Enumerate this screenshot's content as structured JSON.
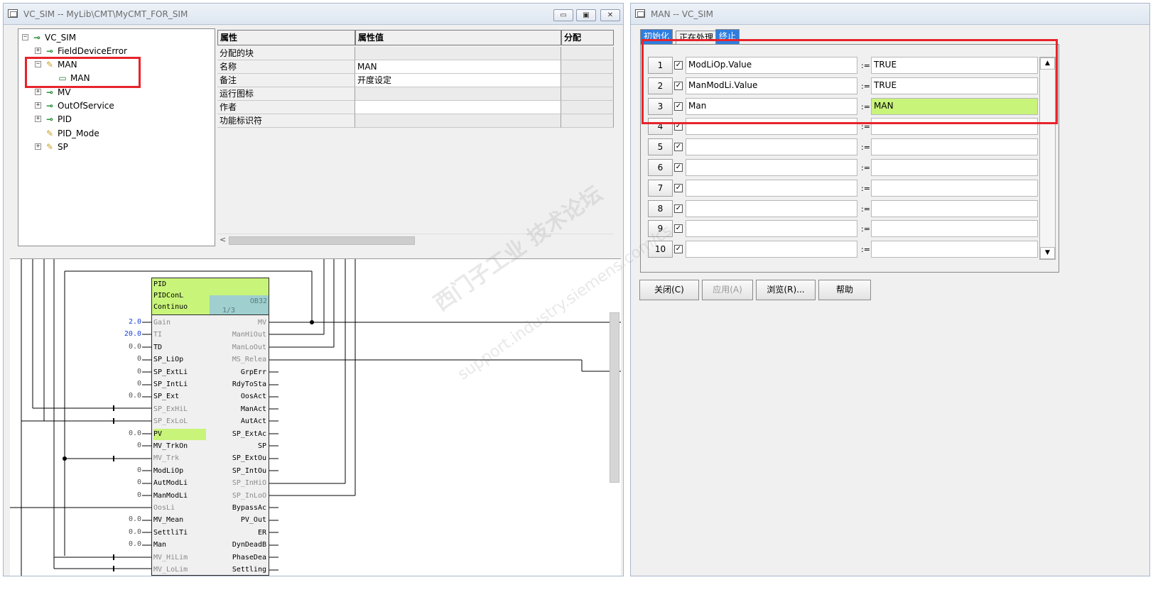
{
  "left_window": {
    "title": "VC_SIM -- MyLib\\CMT\\MyCMT_FOR_SIM",
    "controls": {
      "minimize": "▭",
      "maximize": "▣",
      "close": "✕"
    }
  },
  "tree": {
    "root": "VC_SIM",
    "items": [
      {
        "label": "FieldDeviceError",
        "expander": "+",
        "icon": "green-io-icon"
      },
      {
        "label": "MAN",
        "expander": "−",
        "icon": "pencil-icon"
      },
      {
        "label": "MAN",
        "expander": "",
        "icon": "block-icon"
      },
      {
        "label": "MV",
        "expander": "+",
        "icon": "green-io-icon"
      },
      {
        "label": "OutOfService",
        "expander": "+",
        "icon": "green-io-icon"
      },
      {
        "label": "PID",
        "expander": "+",
        "icon": "green-io-icon"
      },
      {
        "label": "PID_Mode",
        "expander": "",
        "icon": "pencil-icon"
      },
      {
        "label": "SP",
        "expander": "+",
        "icon": "pencil-icon"
      }
    ]
  },
  "props": {
    "headers": [
      "属性",
      "属性值",
      "分配"
    ],
    "rows": [
      {
        "name": "分配的块",
        "value": ""
      },
      {
        "name": "名称",
        "value": "MAN"
      },
      {
        "name": "备注",
        "value": "开度设定"
      },
      {
        "name": "运行图标",
        "value": ""
      },
      {
        "name": "作者",
        "value": ""
      },
      {
        "name": "功能标识符",
        "value": ""
      }
    ],
    "scroll_left": "<"
  },
  "pid_block": {
    "header": [
      "PID",
      "PIDConL",
      "Continuo"
    ],
    "ob": "OB32",
    "page": "1/3",
    "inputs": [
      {
        "name": "Gain",
        "value": "2.0",
        "blue": true,
        "dim": true
      },
      {
        "name": "TI",
        "value": "20.0",
        "blue": true,
        "dim": true
      },
      {
        "name": "TD",
        "value": "0.0",
        "blue": false,
        "dim": false
      },
      {
        "name": "SP_LiOp",
        "value": "0",
        "blue": false,
        "dim": false
      },
      {
        "name": "SP_ExtLi",
        "value": "0",
        "blue": false,
        "dim": false
      },
      {
        "name": "SP_IntLi",
        "value": "0",
        "blue": false,
        "dim": false
      },
      {
        "name": "SP_Ext",
        "value": "0.0",
        "blue": false,
        "dim": false
      },
      {
        "name": "SP_ExHiL",
        "value": "",
        "blue": false,
        "dim": true
      },
      {
        "name": "SP_ExLoL",
        "value": "",
        "blue": false,
        "dim": true
      },
      {
        "name": "PV",
        "value": "0.0",
        "blue": false,
        "dim": false
      },
      {
        "name": "MV_TrkOn",
        "value": "0",
        "blue": false,
        "dim": false
      },
      {
        "name": "MV_Trk",
        "value": "",
        "blue": false,
        "dim": true
      },
      {
        "name": "ModLiOp",
        "value": "0",
        "blue": false,
        "dim": false
      },
      {
        "name": "AutModLi",
        "value": "0",
        "blue": false,
        "dim": false
      },
      {
        "name": "ManModLi",
        "value": "0",
        "blue": false,
        "dim": false
      },
      {
        "name": "OosLi",
        "value": "",
        "blue": false,
        "dim": true
      },
      {
        "name": "MV_Mean",
        "value": "0.0",
        "blue": false,
        "dim": false
      },
      {
        "name": "SettliTi",
        "value": "0.0",
        "blue": false,
        "dim": false
      },
      {
        "name": "Man",
        "value": "0.0",
        "blue": false,
        "dim": false
      },
      {
        "name": "MV_HiLim",
        "value": "",
        "blue": false,
        "dim": true
      },
      {
        "name": "MV_LoLim",
        "value": "",
        "blue": false,
        "dim": true
      }
    ],
    "outputs": [
      {
        "name": "MV",
        "dim": true
      },
      {
        "name": "ManHiOut",
        "dim": true
      },
      {
        "name": "ManLoOut",
        "dim": true
      },
      {
        "name": "MS_Relea",
        "dim": true
      },
      {
        "name": "GrpErr",
        "dim": false
      },
      {
        "name": "RdyToSta",
        "dim": false
      },
      {
        "name": "OosAct",
        "dim": false
      },
      {
        "name": "ManAct",
        "dim": false
      },
      {
        "name": "AutAct",
        "dim": false
      },
      {
        "name": "SP_ExtAc",
        "dim": false
      },
      {
        "name": "SP",
        "dim": false
      },
      {
        "name": "SP_ExtOu",
        "dim": false
      },
      {
        "name": "SP_IntOu",
        "dim": false
      },
      {
        "name": "SP_InHiO",
        "dim": true
      },
      {
        "name": "SP_InLoO",
        "dim": true
      },
      {
        "name": "BypassAc",
        "dim": false
      },
      {
        "name": "PV_Out",
        "dim": false
      },
      {
        "name": "ER",
        "dim": false
      },
      {
        "name": "DynDeadB",
        "dim": false
      },
      {
        "name": "PhaseDea",
        "dim": false
      },
      {
        "name": "Settling",
        "dim": false
      }
    ]
  },
  "right_window": {
    "title": "MAN -- VC_SIM",
    "tabs": [
      "初始化",
      "正在处理",
      "终止"
    ],
    "assign_symbol": ":=",
    "check_mark": "✓",
    "rows": [
      {
        "num": "1",
        "left": "ModLiOp.Value",
        "right": "TRUE",
        "highlight": false
      },
      {
        "num": "2",
        "left": "ManModLi.Value",
        "right": "TRUE",
        "highlight": false
      },
      {
        "num": "3",
        "left": "Man",
        "right": "MAN",
        "highlight": true
      },
      {
        "num": "4",
        "left": "",
        "right": "",
        "highlight": false
      },
      {
        "num": "5",
        "left": "",
        "right": "",
        "highlight": false
      },
      {
        "num": "6",
        "left": "",
        "right": "",
        "highlight": false
      },
      {
        "num": "7",
        "left": "",
        "right": "",
        "highlight": false
      },
      {
        "num": "8",
        "left": "",
        "right": "",
        "highlight": false
      },
      {
        "num": "9",
        "left": "",
        "right": "",
        "highlight": false
      },
      {
        "num": "10",
        "left": "",
        "right": "",
        "highlight": false
      }
    ],
    "buttons": [
      {
        "label": "关闭(C)",
        "disabled": false
      },
      {
        "label": "应用(A)",
        "disabled": true
      },
      {
        "label": "浏览(R)...",
        "disabled": false
      },
      {
        "label": "帮助",
        "disabled": false
      }
    ],
    "scroll_up": "▲",
    "scroll_down": "▼"
  },
  "watermark": {
    "line1": "西门子工业 技术论坛",
    "line2": "support.industry.siemens.com/cs"
  },
  "colors": {
    "highlight": "#c8f47a",
    "annotation": "#e8232b",
    "tab_active": "#2e7de0"
  }
}
